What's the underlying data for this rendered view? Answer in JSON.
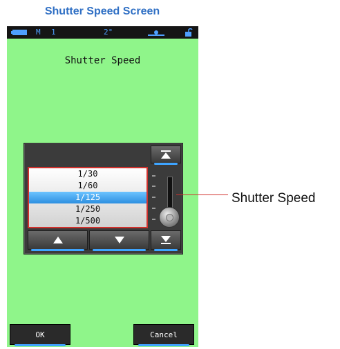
{
  "caption": "Shutter Speed Screen",
  "status_bar": {
    "mode": "M",
    "memory": "1",
    "angle": "2°"
  },
  "screen_title": "Shutter Speed",
  "shutter_list": {
    "items": [
      "1/30",
      "1/60",
      "1/125",
      "1/250",
      "1/500"
    ],
    "selected": "1/125"
  },
  "callout_label": "Shutter Speed",
  "buttons": {
    "ok": "OK",
    "cancel": "Cancel"
  }
}
